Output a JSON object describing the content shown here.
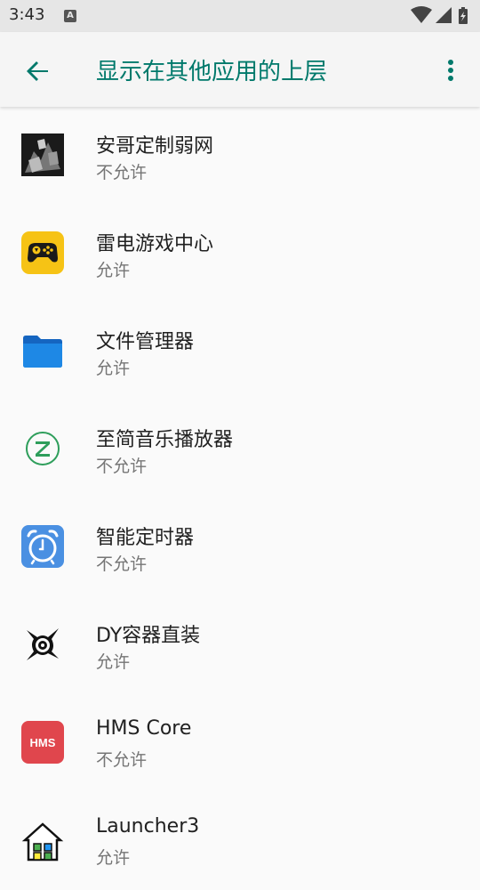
{
  "status_bar": {
    "time": "3:43",
    "notification_icon": "a-icon",
    "icons": [
      "wifi-icon",
      "signal-icon",
      "battery-charging-icon"
    ]
  },
  "app_bar": {
    "title": "显示在其他应用的上层",
    "back_icon": "arrow-back-icon",
    "more_icon": "more-vert-icon"
  },
  "colors": {
    "accent": "#00796b",
    "status_bar_bg": "#e6e6e6",
    "app_bar_bg": "#f5f5f5",
    "background": "#fafafa"
  },
  "apps": [
    {
      "name": "安哥定制弱网",
      "status": "不允许",
      "icon": "photo-app-icon"
    },
    {
      "name": "雷电游戏中心",
      "status": "允许",
      "icon": "gamepad-app-icon"
    },
    {
      "name": "文件管理器",
      "status": "允许",
      "icon": "folder-app-icon"
    },
    {
      "name": "至简音乐播放器",
      "status": "不允许",
      "icon": "z-music-app-icon"
    },
    {
      "name": "智能定时器",
      "status": "不允许",
      "icon": "alarm-clock-app-icon"
    },
    {
      "name": "DY容器直装",
      "status": "允许",
      "icon": "dy-eye-app-icon"
    },
    {
      "name": "HMS Core",
      "status": "不允许",
      "icon": "hms-app-icon",
      "icon_text": "HMS"
    },
    {
      "name": "Launcher3",
      "status": "允许",
      "icon": "house-app-icon"
    }
  ]
}
